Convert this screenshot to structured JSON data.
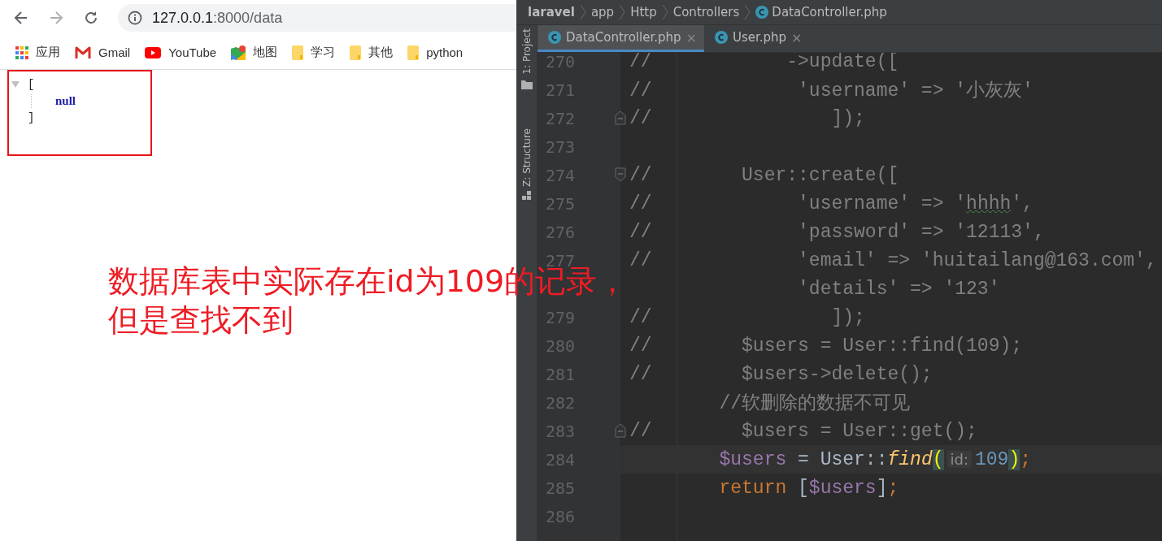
{
  "browser": {
    "nav": [
      {
        "kind": "back",
        "disabled": false
      },
      {
        "kind": "forward",
        "disabled": true
      },
      {
        "kind": "reload",
        "disabled": false
      }
    ],
    "address": {
      "host": "127.0.0.1",
      "path": ":8000/data"
    },
    "bookmarks": [
      {
        "kind": "apps",
        "label": "应用"
      },
      {
        "kind": "gmail",
        "label": "Gmail"
      },
      {
        "kind": "youtube",
        "label": "YouTube"
      },
      {
        "kind": "maps",
        "label": "地图"
      },
      {
        "kind": "folder",
        "label": "学习"
      },
      {
        "kind": "folder",
        "label": "其他"
      },
      {
        "kind": "folder",
        "label": "python"
      }
    ],
    "json_view": {
      "expanded": true,
      "open": "[",
      "items": [
        "null"
      ],
      "close": "]"
    }
  },
  "annotation": {
    "lines": [
      "数据库表中实际存在id为109的记录，",
      "但是查找不到"
    ]
  },
  "ide": {
    "breadcrumbs": [
      {
        "label": "laravel",
        "kind": "root"
      },
      {
        "label": "app",
        "kind": "dir"
      },
      {
        "label": "Http",
        "kind": "dir"
      },
      {
        "label": "Controllers",
        "kind": "dir"
      },
      {
        "label": "DataController.php",
        "kind": "class"
      }
    ],
    "tool_windows": [
      {
        "label": "1: Project",
        "kind": "project"
      },
      {
        "label": "Z: Structure",
        "kind": "structure"
      }
    ],
    "tabs": [
      {
        "label": "DataController.php",
        "selected": true,
        "close": "×"
      },
      {
        "label": "User.php",
        "selected": false,
        "close": "×"
      }
    ],
    "lines": [
      {
        "number": "270",
        "tokens": [
          {
            "text": "//            ->update([",
            "kind": "comment"
          }
        ]
      },
      {
        "number": "271",
        "tokens": [
          {
            "text": "//             'username' => '小灰灰'",
            "kind": "comment"
          }
        ]
      },
      {
        "number": "272",
        "fold_end": true,
        "tokens": [
          {
            "text": "//                ]);",
            "kind": "comment"
          }
        ]
      },
      {
        "number": "273"
      },
      {
        "number": "274",
        "fold_start": true,
        "tokens": [
          {
            "text": "//        User::create([",
            "kind": "comment"
          }
        ]
      },
      {
        "number": "275",
        "tokens": [
          {
            "text": "//             'username' => '",
            "kind": "comment"
          },
          {
            "text": "hhhh",
            "kind": "typo"
          },
          {
            "text": "',",
            "kind": "comment"
          }
        ]
      },
      {
        "number": "276",
        "tokens": [
          {
            "text": "//             'password' => '12113',",
            "kind": "comment"
          }
        ]
      },
      {
        "number": "277",
        "tokens": [
          {
            "text": "//             'email' => 'huitailang@163.com',",
            "kind": "comment"
          }
        ]
      },
      {
        "tokens": [
          {
            "text": "               'details' => '123'",
            "kind": "comment"
          }
        ]
      },
      {
        "number": "279",
        "tokens": [
          {
            "text": "//                ]);",
            "kind": "comment"
          }
        ]
      },
      {
        "number": "280",
        "tokens": [
          {
            "text": "//        $users = User::find(109);",
            "kind": "comment"
          }
        ]
      },
      {
        "number": "281",
        "tokens": [
          {
            "text": "//        $users->delete();",
            "kind": "comment"
          }
        ]
      },
      {
        "number": "282",
        "tokens": [
          {
            "text": "        //软删除的数据不可见",
            "kind": "comment"
          }
        ]
      },
      {
        "number": "283",
        "fold_end": true,
        "tokens": [
          {
            "text": "//        $users = User::get();",
            "kind": "comment"
          }
        ]
      },
      {
        "number": "284",
        "current": true,
        "tokens": [
          {
            "text": "        $users",
            "kind": "var"
          },
          {
            "text": " = User::",
            "kind": "plain"
          },
          {
            "text": "find",
            "kind": "func"
          },
          {
            "text": "(",
            "kind": "paren"
          },
          {
            "text": "id:",
            "kind": "hint"
          },
          {
            "text": "109",
            "kind": "number"
          },
          {
            "text": ")",
            "kind": "paren"
          },
          {
            "text": ";",
            "kind": "punct"
          }
        ]
      },
      {
        "number": "285",
        "tokens": [
          {
            "text": "        return",
            "kind": "keyword"
          },
          {
            "text": " [",
            "kind": "plain"
          },
          {
            "text": "$users",
            "kind": "var"
          },
          {
            "text": "]",
            "kind": "plain"
          },
          {
            "text": ";",
            "kind": "punct"
          }
        ]
      },
      {
        "number": "286"
      }
    ]
  }
}
